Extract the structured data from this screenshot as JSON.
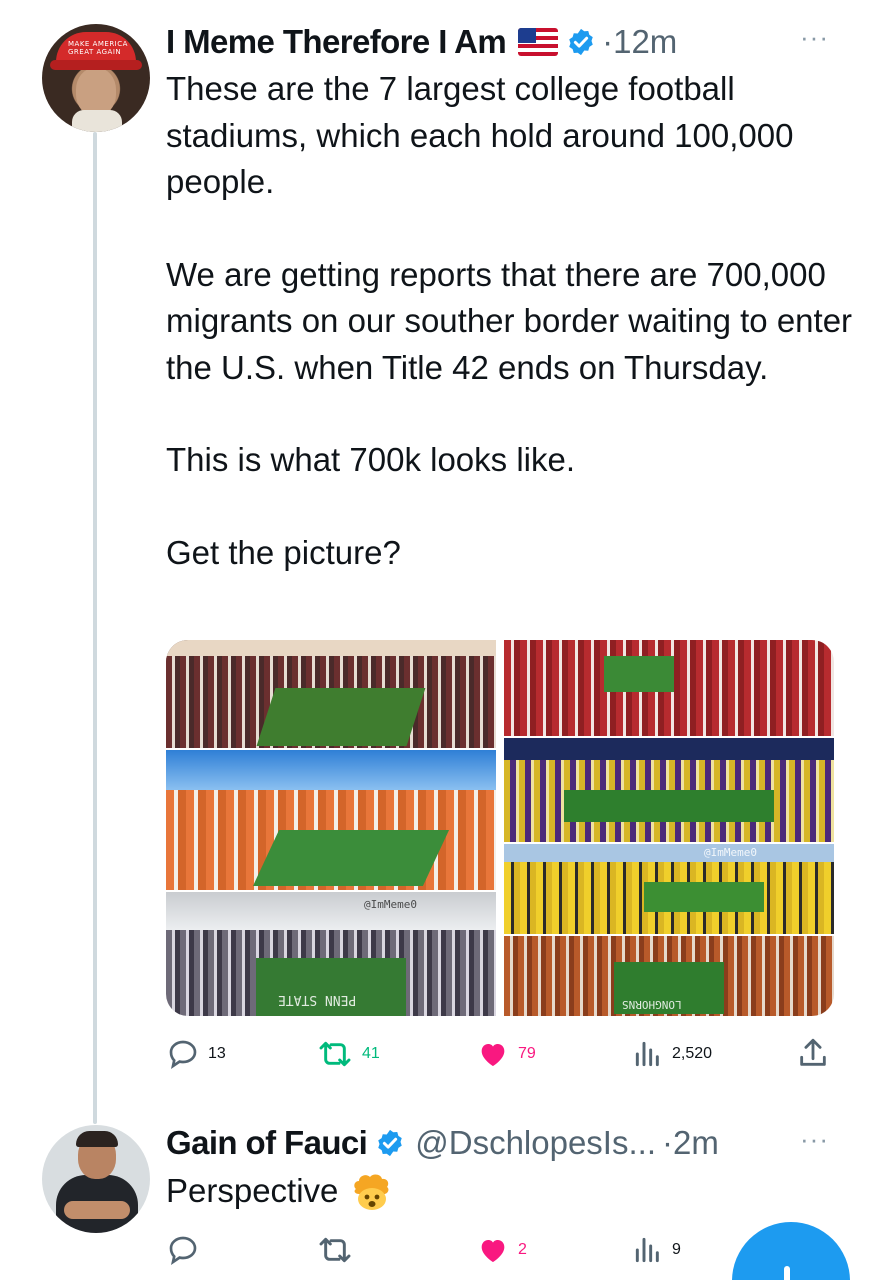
{
  "tweet": {
    "author": {
      "name": "I Meme Therefore I Am",
      "avatar_hat_text": "MAKE AMERICA GREAT AGAIN"
    },
    "time": "·12m",
    "more": "···",
    "paragraphs": [
      "These are the 7 largest college football stadiums, which each hold around 100,000 people.",
      "We are getting reports that there are 700,000 migrants on our souther border waiting to enter the U.S. when Title 42 ends on Thursday.",
      "This is what 700k looks like.",
      "Get the picture?"
    ],
    "media": {
      "watermarks": [
        "@ImMeme0",
        "@ImMeme0"
      ],
      "field_texts": [
        "PENN STATE",
        "LONGHORNS"
      ]
    },
    "stats": {
      "replies": "13",
      "retweets": "41",
      "likes": "79",
      "views": "2,520"
    }
  },
  "reply": {
    "author": {
      "name": "Gain of Fauci",
      "handle": "@DschlopesIs..."
    },
    "time": "·2m",
    "more": "···",
    "text": "Perspective",
    "stats": {
      "replies": "",
      "retweets": "",
      "likes": "2",
      "views": "9"
    }
  },
  "colors": {
    "accent": "#1d9bf0",
    "like": "#f91880",
    "retweet": "#00ba7c",
    "muted": "#536471"
  },
  "icons": [
    "more-icon",
    "verified-icon",
    "us-flag-icon",
    "reply-icon",
    "retweet-icon",
    "like-icon",
    "views-icon",
    "share-icon",
    "exploding-head-emoji",
    "compose-icon"
  ]
}
